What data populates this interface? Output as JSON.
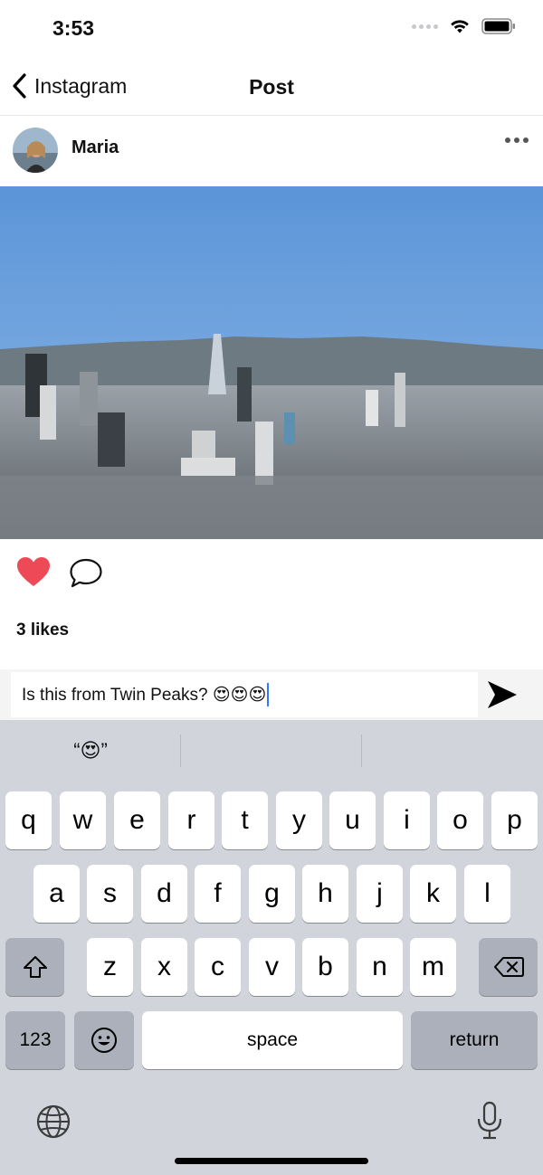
{
  "status_bar": {
    "time": "3:53"
  },
  "nav": {
    "back_label": "Instagram",
    "title": "Post"
  },
  "post": {
    "username": "Maria",
    "likes": "3 likes"
  },
  "comment": {
    "text": "Is this from Twin Peaks? 😍😍😍"
  },
  "keyboard": {
    "suggestions": [
      "",
      "“😍”",
      "",
      ""
    ],
    "row1": [
      "q",
      "w",
      "e",
      "r",
      "t",
      "y",
      "u",
      "i",
      "o",
      "p"
    ],
    "row2": [
      "a",
      "s",
      "d",
      "f",
      "g",
      "h",
      "j",
      "k",
      "l"
    ],
    "row3": [
      "z",
      "x",
      "c",
      "v",
      "b",
      "n",
      "m"
    ],
    "numbers_label": "123",
    "space_label": "space",
    "return_label": "return"
  },
  "icons": {
    "back": "chevron-left-icon",
    "more": "more-horizontal-icon",
    "like": "heart-icon",
    "comment": "comment-icon",
    "send": "send-icon",
    "shift": "shift-icon",
    "delete": "backspace-icon",
    "emoji": "emoji-icon",
    "globe": "globe-icon",
    "mic": "microphone-icon"
  },
  "colors": {
    "heart": "#ed4956",
    "caret": "#3478f6",
    "keyboard_bg": "#d1d4da"
  }
}
